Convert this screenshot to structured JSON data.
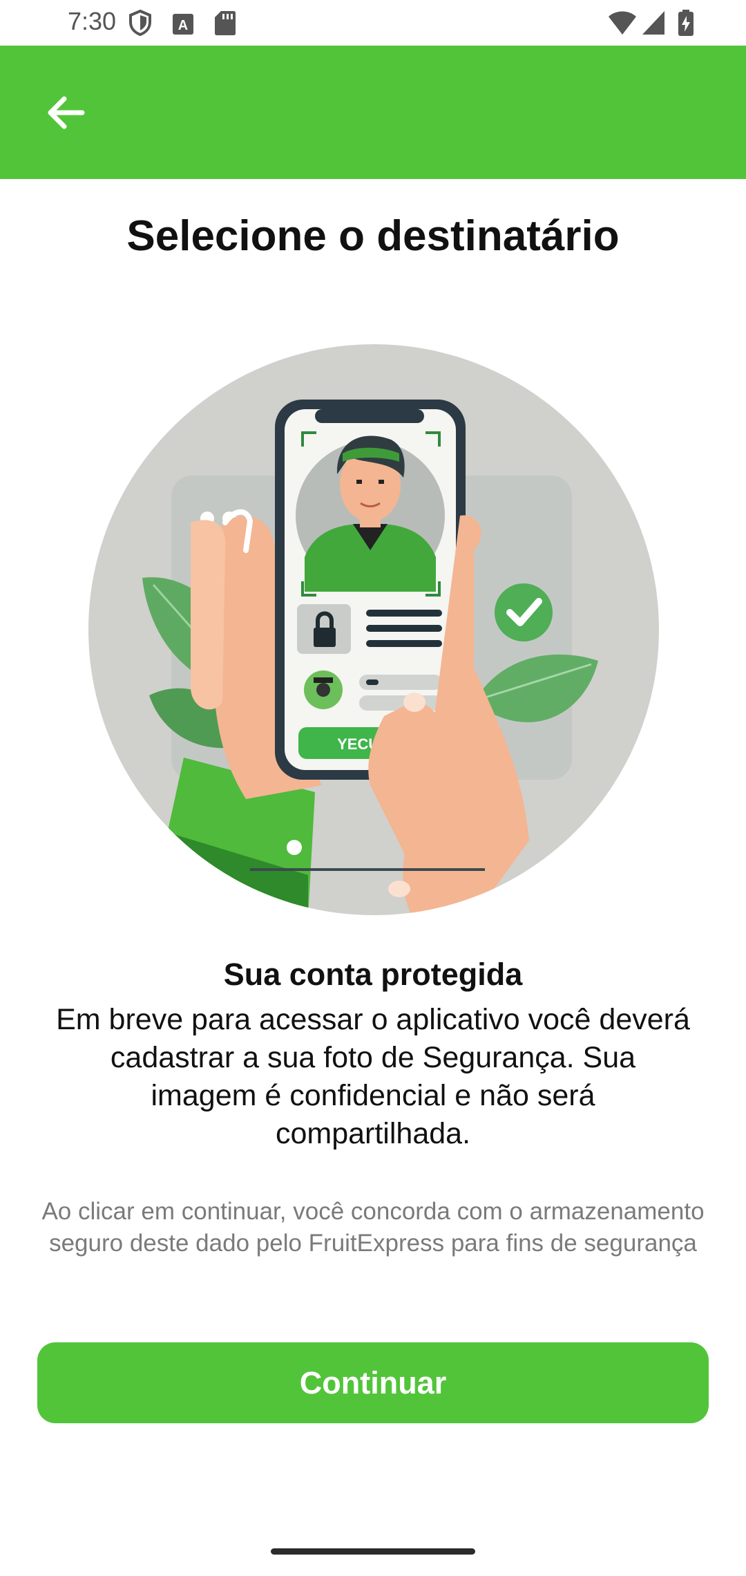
{
  "status_bar": {
    "time": "7:30",
    "icons": [
      "shield-icon",
      "font-a-icon",
      "sd-card-icon",
      "wifi-icon",
      "signal-icon",
      "battery-charging-icon"
    ]
  },
  "app_bar": {
    "back_icon": "arrow-back-icon",
    "color": "#52c43a"
  },
  "page": {
    "title": "Selecione o destinatário",
    "illustration_button_text": "YECURIY",
    "heading": "Sua conta protegida",
    "body": "Em breve para acessar o aplicativo você deverá cadastrar a sua foto de Segurança. Sua imagem é confidencial e não será compartilhada.",
    "consent": "Ao clicar em continuar, você concorda com o armazenamento seguro deste dado pelo FruitExpress para fins de segurança",
    "continue_label": "Continuar"
  },
  "colors": {
    "accent": "#52c43a",
    "text": "#111111",
    "muted_text": "#7a7a7a"
  }
}
